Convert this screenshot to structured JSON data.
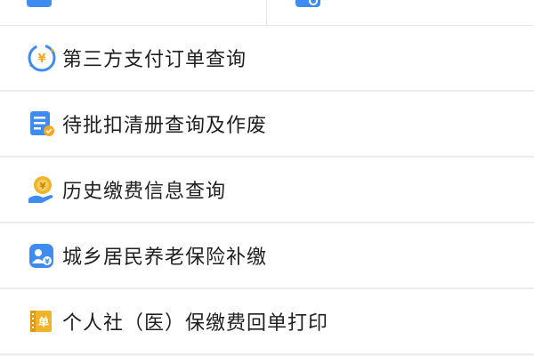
{
  "top_row": {
    "left_label": "",
    "right_label": ""
  },
  "menu": {
    "items": [
      {
        "label": "第三方支付订单查询",
        "icon": "third-party-payment-icon"
      },
      {
        "label": "待批扣清册查询及作废",
        "icon": "pending-deduction-list-icon"
      },
      {
        "label": "历史缴费信息查询",
        "icon": "payment-history-icon"
      },
      {
        "label": "城乡居民养老保险补缴",
        "icon": "pension-insurance-icon"
      },
      {
        "label": "个人社（医）保缴费回单打印",
        "icon": "receipt-print-icon"
      }
    ]
  },
  "colors": {
    "accent_blue": "#3f8cf1",
    "accent_orange": "#f5a623",
    "accent_gold": "#f0b429",
    "divider": "#ececec",
    "text": "#1f1f1f"
  }
}
